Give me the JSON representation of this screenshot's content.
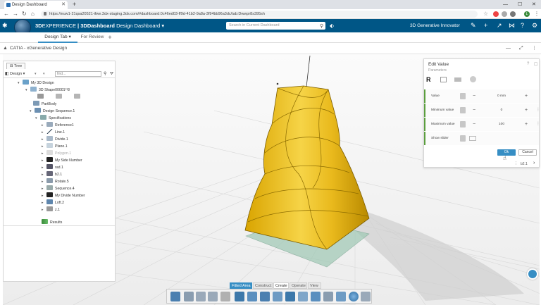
{
  "browser": {
    "tab_title": "Design Dashboard",
    "url": "https://euw1-21qsa20521-ifwe.3dx-staging.3ds.com/#dashboard:0c46ed03-ff9d-41b2-9a8a-3f94bb96a3dc/tab:Dwwpr8s395sh",
    "user_initial": "L"
  },
  "appbar": {
    "brand_3d": "3D",
    "brand_experience": "EXPERIENCE",
    "brand_app": "| 3DDashboard",
    "dashboard_name": "Design Dashboard",
    "search_placeholder": "Search in Current Dashboard",
    "role": "3D Generative Innovator"
  },
  "dashboard_tabs": [
    {
      "label": "Design Tab"
    },
    {
      "label": "For Review"
    }
  ],
  "widget": {
    "title": "CATIA - xGenerative Design"
  },
  "tree": {
    "tab_label": "Tree",
    "dropdown": "Design",
    "find_placeholder": "find...",
    "items": [
      {
        "label": "My 3D Design"
      },
      {
        "label": "3D Shape00001¹¹8"
      },
      {
        "label": ""
      },
      {
        "label": "PartBody"
      },
      {
        "label": "Design Sequence.1"
      },
      {
        "label": "Specifications"
      },
      {
        "label": "Reference1"
      },
      {
        "label": "Line.1"
      },
      {
        "label": "Divide.1"
      },
      {
        "label": "Plane.1"
      },
      {
        "label": "Polygon.1"
      },
      {
        "label": "My Side Number"
      },
      {
        "label": "rad.1"
      },
      {
        "label": "b2.1"
      },
      {
        "label": "Rotate.5"
      },
      {
        "label": "Sequence.4"
      },
      {
        "label": "My Divide Number"
      },
      {
        "label": "Loft.2"
      },
      {
        "label": "z.1"
      },
      {
        "label": "Results"
      }
    ]
  },
  "edit_panel": {
    "title": "Edit Value",
    "subtitle": "Parameters",
    "rows": [
      {
        "label": "Value",
        "value": "0 mm"
      },
      {
        "label": "Minimum value",
        "value": "0"
      },
      {
        "label": "Maximum value",
        "value": "100"
      },
      {
        "label": "Show slider",
        "value": ""
      }
    ],
    "ok_label": "Ok",
    "cancel_label": "Cancel",
    "page_label": "b2.1"
  },
  "action_bar": {
    "tabs": [
      "Fitted Area",
      "Construct",
      "Create",
      "Operate",
      "View"
    ]
  },
  "colors": {
    "appbar": "#005686",
    "accent": "#368ec4",
    "shape_fill": "#f0c419",
    "spec_green": "#5b9e3e"
  }
}
